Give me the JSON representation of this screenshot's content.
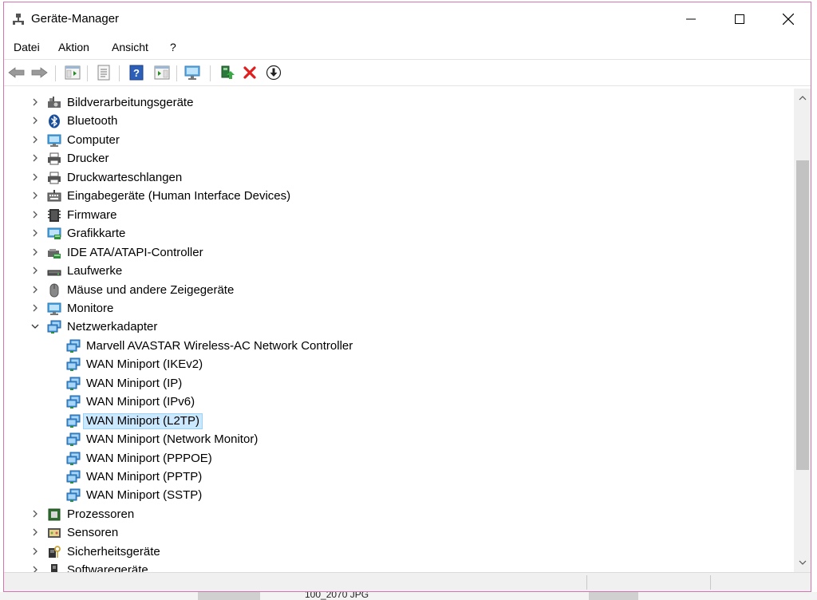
{
  "window": {
    "title": "Geräte-Manager",
    "border_color": "#d674b0"
  },
  "menu": [
    "Datei",
    "Aktion",
    "Ansicht",
    "?"
  ],
  "toolbar": {
    "buttons": [
      "back-icon",
      "forward-icon",
      "properties-icon",
      "update-view-icon",
      "help-icon",
      "show-hide-console-tree-icon",
      "scan-hardware-icon",
      "update-driver-icon",
      "uninstall-icon",
      "disable-device-icon"
    ]
  },
  "tree": [
    {
      "label": "Bildverarbeitungsgeräte",
      "icon": "camera-icon",
      "level": 0,
      "expander": "collapsed"
    },
    {
      "label": "Bluetooth",
      "icon": "bluetooth-icon",
      "level": 0,
      "expander": "collapsed"
    },
    {
      "label": "Computer",
      "icon": "computer-icon",
      "level": 0,
      "expander": "collapsed"
    },
    {
      "label": "Drucker",
      "icon": "printer-icon",
      "level": 0,
      "expander": "collapsed"
    },
    {
      "label": "Druckwarteschlangen",
      "icon": "print-queue-icon",
      "level": 0,
      "expander": "collapsed"
    },
    {
      "label": "Eingabegeräte (Human Interface Devices)",
      "icon": "keyboard-icon",
      "level": 0,
      "expander": "collapsed"
    },
    {
      "label": "Firmware",
      "icon": "firmware-icon",
      "level": 0,
      "expander": "collapsed"
    },
    {
      "label": "Grafikkarte",
      "icon": "display-adapter-icon",
      "level": 0,
      "expander": "collapsed"
    },
    {
      "label": "IDE ATA/ATAPI-Controller",
      "icon": "ide-controller-icon",
      "level": 0,
      "expander": "collapsed"
    },
    {
      "label": "Laufwerke",
      "icon": "disk-drive-icon",
      "level": 0,
      "expander": "collapsed"
    },
    {
      "label": "Mäuse und andere Zeigegeräte",
      "icon": "mouse-icon",
      "level": 0,
      "expander": "collapsed"
    },
    {
      "label": "Monitore",
      "icon": "monitor-icon",
      "level": 0,
      "expander": "collapsed"
    },
    {
      "label": "Netzwerkadapter",
      "icon": "network-adapter-icon",
      "level": 0,
      "expander": "expanded"
    },
    {
      "label": "Marvell AVASTAR Wireless-AC Network Controller",
      "icon": "network-adapter-icon",
      "level": 1,
      "expander": "none"
    },
    {
      "label": "WAN Miniport (IKEv2)",
      "icon": "network-adapter-icon",
      "level": 1,
      "expander": "none"
    },
    {
      "label": "WAN Miniport (IP)",
      "icon": "network-adapter-icon",
      "level": 1,
      "expander": "none"
    },
    {
      "label": "WAN Miniport (IPv6)",
      "icon": "network-adapter-icon",
      "level": 1,
      "expander": "none"
    },
    {
      "label": "WAN Miniport (L2TP)",
      "icon": "network-adapter-icon",
      "level": 1,
      "expander": "none",
      "selected": true
    },
    {
      "label": "WAN Miniport (Network Monitor)",
      "icon": "network-adapter-icon",
      "level": 1,
      "expander": "none"
    },
    {
      "label": "WAN Miniport (PPPOE)",
      "icon": "network-adapter-icon",
      "level": 1,
      "expander": "none"
    },
    {
      "label": "WAN Miniport (PPTP)",
      "icon": "network-adapter-icon",
      "level": 1,
      "expander": "none"
    },
    {
      "label": "WAN Miniport (SSTP)",
      "icon": "network-adapter-icon",
      "level": 1,
      "expander": "none"
    },
    {
      "label": "Prozessoren",
      "icon": "processor-icon",
      "level": 0,
      "expander": "collapsed"
    },
    {
      "label": "Sensoren",
      "icon": "sensor-icon",
      "level": 0,
      "expander": "collapsed"
    },
    {
      "label": "Sicherheitsgeräte",
      "icon": "security-device-icon",
      "level": 0,
      "expander": "collapsed"
    },
    {
      "label": "Softwaregeräte",
      "icon": "software-device-icon",
      "level": 0,
      "expander": "collapsed"
    }
  ],
  "background": {
    "taskbar_text": "100_2070 JPG"
  },
  "colors": {
    "selection": "#cce8ff",
    "selection_border": "#99d1ff",
    "network_icon": "#3b8fd6"
  }
}
